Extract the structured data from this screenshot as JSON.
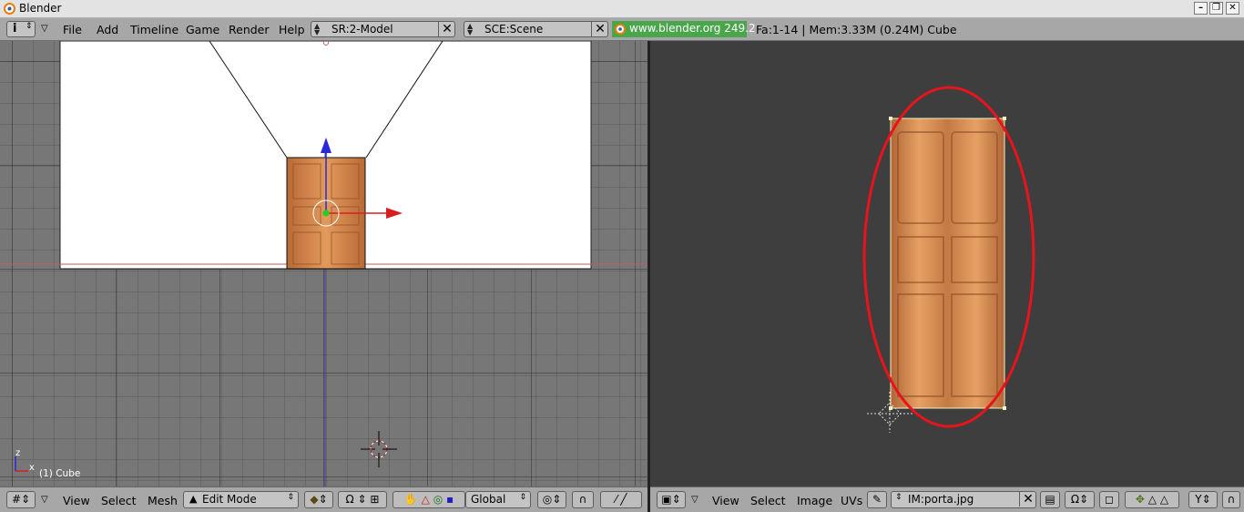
{
  "window": {
    "title": "Blender"
  },
  "menubar": {
    "menus": [
      "File",
      "Add",
      "Timeline",
      "Game",
      "Render",
      "Help"
    ],
    "screen_field": "SR:2-Model",
    "scene_field": "SCE:Scene",
    "url_badge": "www.blender.org 249.2",
    "stats": "Fa:1-14 | Mem:3.33M (0.24M) Cube"
  },
  "view3d": {
    "object_label": "(1) Cube",
    "axis_x": "x",
    "axis_z": "z"
  },
  "header3d": {
    "menus": [
      "View",
      "Select",
      "Mesh"
    ],
    "mode": "Edit Mode",
    "orientation": "Global"
  },
  "headerUV": {
    "menus": [
      "View",
      "Select",
      "Image",
      "UVs"
    ],
    "image_field": "IM:porta.jpg"
  },
  "colors": {
    "wood_light": "#e39a5c",
    "wood_dark": "#b86a36",
    "annotation": "#e8141c",
    "url_badge_bg": "#49a64b"
  }
}
